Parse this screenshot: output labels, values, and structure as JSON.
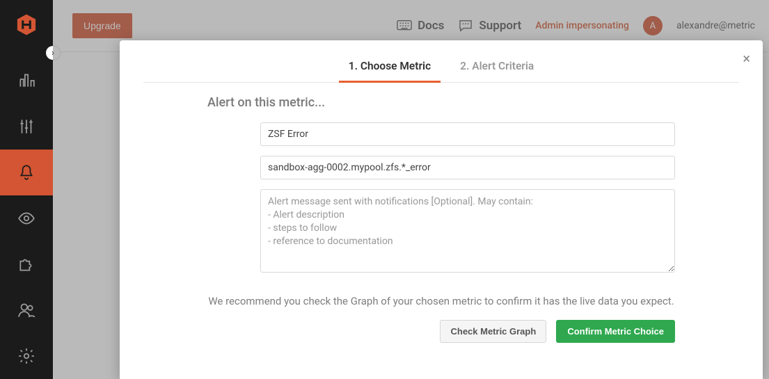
{
  "sidebar": {
    "expander_glyph": "›"
  },
  "topbar": {
    "upgrade_label": "Upgrade",
    "docs_label": "Docs",
    "support_label": "Support",
    "impersonating_label": "Admin impersonating",
    "avatar_initial": "A",
    "user_email": "alexandre@metric"
  },
  "modal": {
    "close_glyph": "×",
    "tabs": {
      "choose_metric": "1. Choose Metric",
      "alert_criteria": "2. Alert Criteria"
    },
    "section_title": "Alert on this metric...",
    "metric_name_value": "ZSF Error",
    "metric_path_value": "sandbox-agg-0002.mypool.zfs.*_error",
    "message_placeholder": "Alert message sent with notifications [Optional]. May contain:\n- Alert description\n- steps to follow\n- reference to documentation",
    "recommend_text": "We recommend you check the Graph of your chosen metric to confirm it has the live data you expect.",
    "check_graph_label": "Check Metric Graph",
    "confirm_label": "Confirm Metric Choice"
  }
}
